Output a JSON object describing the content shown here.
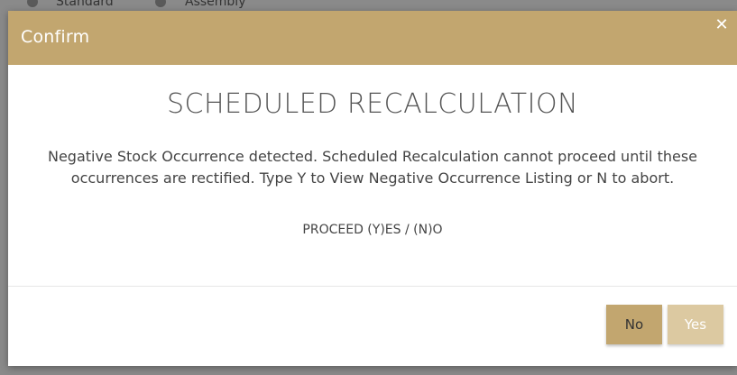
{
  "background": {
    "radio_1_label": "Standard",
    "radio_2_label": "Assembly"
  },
  "dialog": {
    "title": "Confirm",
    "close_icon": "close-icon",
    "headline": "SCHEDULED RECALCULATION",
    "message": "Negative Stock Occurrence detected. Scheduled Recalculation cannot proceed until these occurrences are rectified. Type Y to View Negative Occurrence Listing or N to abort.",
    "prompt": "PROCEED (Y)ES / (N)O",
    "buttons": {
      "no_label": "No",
      "yes_label": "Yes"
    }
  },
  "colors": {
    "header": "#c2a66f",
    "button_primary": "#c2a66f",
    "button_secondary": "#dcc9a1"
  }
}
